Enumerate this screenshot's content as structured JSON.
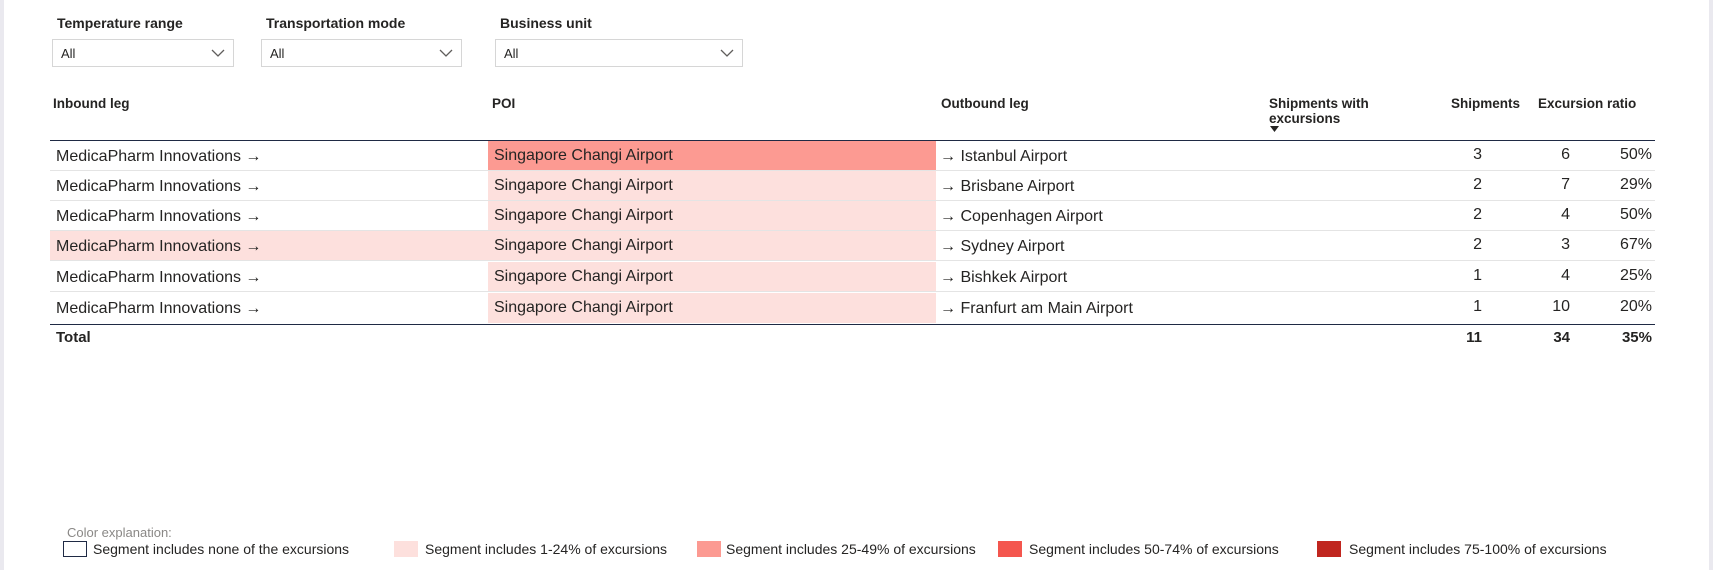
{
  "filters": [
    {
      "label": "Temperature range",
      "value": "All"
    },
    {
      "label": "Transportation mode",
      "value": "All"
    },
    {
      "label": "Business unit",
      "value": "All"
    }
  ],
  "table": {
    "columns": {
      "inbound": "Inbound leg",
      "poi": "POI",
      "outbound": "Outbound leg",
      "shipments_with_excursions": "Shipments with excursions",
      "shipments": "Shipments",
      "excursion_ratio": "Excursion ratio"
    },
    "rows": [
      {
        "inbound": "MedicaPharm Innovations →",
        "poi": "Singapore Changi Airport",
        "outbound": "→ Istanbul Airport",
        "with_exc": "3",
        "shipments": "6",
        "ratio": "50%"
      },
      {
        "inbound": "MedicaPharm Innovations →",
        "poi": "Singapore Changi Airport",
        "outbound": "→ Brisbane Airport",
        "with_exc": "2",
        "shipments": "7",
        "ratio": "29%"
      },
      {
        "inbound": "MedicaPharm Innovations →",
        "poi": "Singapore Changi Airport",
        "outbound": "→ Copenhagen Airport",
        "with_exc": "2",
        "shipments": "4",
        "ratio": "50%"
      },
      {
        "inbound": "MedicaPharm Innovations →",
        "poi": "Singapore Changi Airport",
        "outbound": "→ Sydney Airport",
        "with_exc": "2",
        "shipments": "3",
        "ratio": "67%"
      },
      {
        "inbound": "MedicaPharm Innovations →",
        "poi": "Singapore Changi Airport",
        "outbound": "→ Bishkek Airport",
        "with_exc": "1",
        "shipments": "4",
        "ratio": "25%"
      },
      {
        "inbound": "MedicaPharm Innovations →",
        "poi": "Singapore Changi Airport",
        "outbound": "→ Franfurt am Main Airport",
        "with_exc": "1",
        "shipments": "10",
        "ratio": "20%"
      }
    ],
    "total": {
      "label": "Total",
      "with_exc": "11",
      "shipments": "34",
      "ratio": "35%"
    }
  },
  "legend": {
    "title": "Color explanation:",
    "items": [
      {
        "label": "Segment includes none of the excursions",
        "color": "#ffffff",
        "border": "#1f2a44"
      },
      {
        "label": "Segment includes 1-24% of excursions",
        "color": "#fde0dd"
      },
      {
        "label": "Segment includes 25-49% of excursions",
        "color": "#fc9a92"
      },
      {
        "label": "Segment includes 50-74% of excursions",
        "color": "#f4564e"
      },
      {
        "label": "Segment includes 75-100% of excursions",
        "color": "#c0261f"
      }
    ]
  },
  "colors": {
    "none": "#ffffff",
    "low": "#fde0dd",
    "mid": "#fc9a92",
    "high": "#f4564e",
    "severe": "#c0261f"
  }
}
